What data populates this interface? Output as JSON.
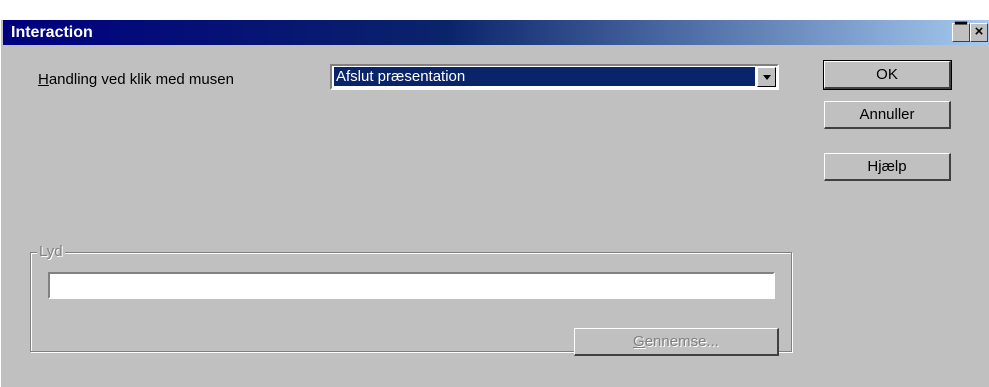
{
  "window": {
    "title": "Interaction",
    "maximize_glyph": "▔",
    "close_glyph": "×"
  },
  "action": {
    "label_first": "H",
    "label_rest": "andling ved klik med musen",
    "selected": "Afslut præsentation"
  },
  "buttons": {
    "ok": "OK",
    "cancel": "Annuller",
    "help_first": "H",
    "help_u": "j",
    "help_rest": "ælp"
  },
  "sound": {
    "group_label": "Lyd",
    "path_value": "",
    "browse_first": "G",
    "browse_rest": "ennemse..."
  },
  "colors": {
    "title_active": "#000080",
    "face": "#c0c0c0",
    "selection": "#0a246a"
  }
}
